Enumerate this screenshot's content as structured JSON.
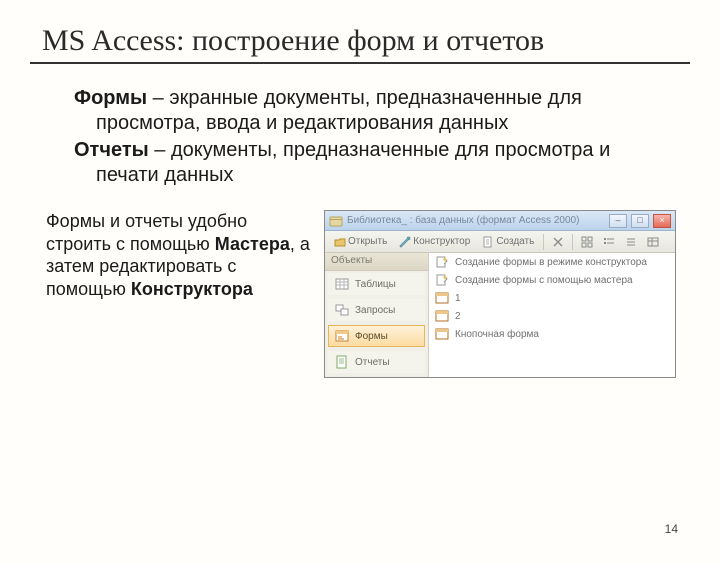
{
  "slide": {
    "title": "MS Access: построение форм и отчетов",
    "def_forms_term": "Формы",
    "def_forms_rest": " – экранные документы, предназначенные для просмотра, ввода и редактирования данных",
    "def_reports_term": "Отчеты",
    "def_reports_rest": " – документы, предназначенные для просмотра и печати данных",
    "para_pre": "Формы и отчеты удобно строить с помощью ",
    "para_b1": "Мастера",
    "para_mid": ", а затем редактировать с помощью ",
    "para_b2": "Конструктора",
    "page_number": "14"
  },
  "app": {
    "titlebar": "Библиотека_ : база данных (формат Access 2000)",
    "toolbar": {
      "open": "Открыть",
      "design": "Конструктор",
      "create": "Создать"
    },
    "sidebar": {
      "header": "Объекты",
      "items": [
        {
          "label": "Таблицы"
        },
        {
          "label": "Запросы"
        },
        {
          "label": "Формы"
        },
        {
          "label": "Отчеты"
        }
      ]
    },
    "content": {
      "items": [
        {
          "label": "Создание формы в режиме конструктора"
        },
        {
          "label": "Создание формы с помощью мастера"
        },
        {
          "label": "1"
        },
        {
          "label": "2"
        },
        {
          "label": "Кнопочная форма"
        }
      ]
    }
  }
}
